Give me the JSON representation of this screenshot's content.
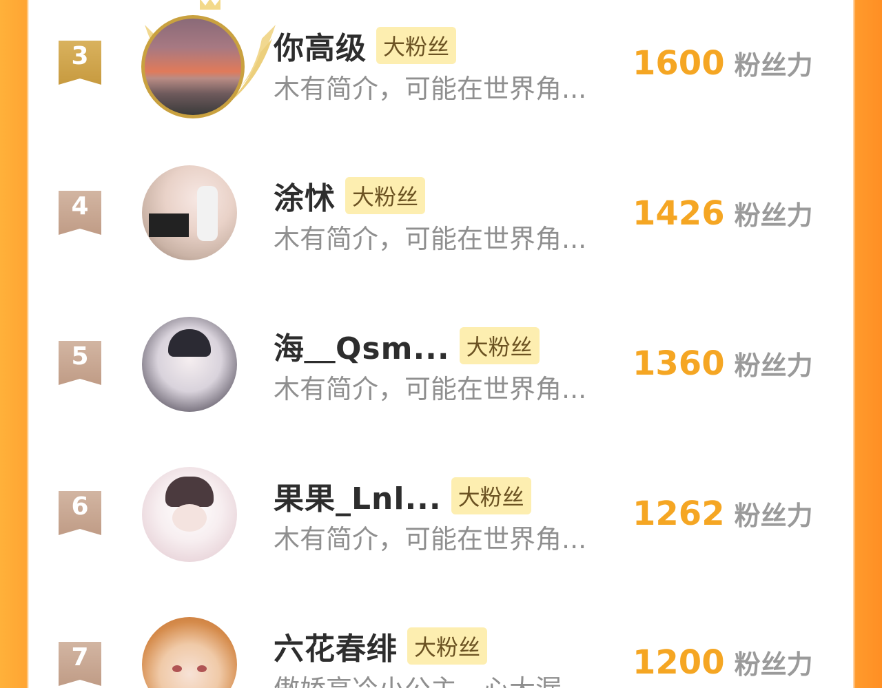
{
  "badge_label": "大粉丝",
  "score_unit": "粉丝力",
  "colors": {
    "accent": "#f5a623",
    "badge_bg": "#fdeeb0",
    "rank_top": "#c79a3f",
    "rank_other": "#c09c86"
  },
  "rows": [
    {
      "rank": "3",
      "name": "你高级",
      "desc": "木有简介，可能在世界角...",
      "score": "1600"
    },
    {
      "rank": "4",
      "name": "涂怵",
      "desc": "木有简介，可能在世界角...",
      "score": "1426"
    },
    {
      "rank": "5",
      "name": "海＿Qsm...",
      "desc": "木有简介，可能在世界角...",
      "score": "1360"
    },
    {
      "rank": "6",
      "name": "果果_Lnl...",
      "desc": "木有简介，可能在世界角...",
      "score": "1262"
    },
    {
      "rank": "7",
      "name": "六花春绯",
      "desc": "傲娇高冷小公主，心大漏",
      "score": "1200"
    }
  ]
}
